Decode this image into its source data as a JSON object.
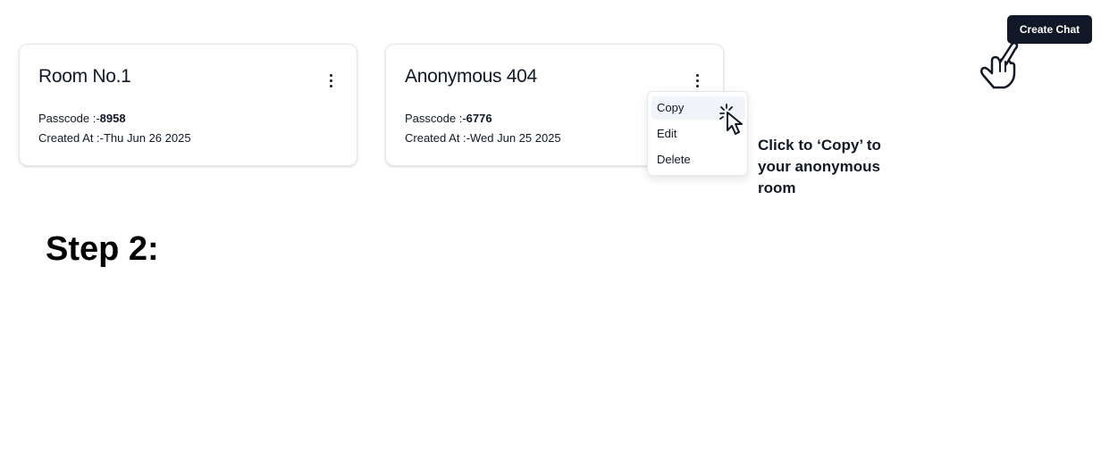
{
  "header": {
    "create_chat_label": "Create Chat"
  },
  "rooms": [
    {
      "title": "Room No.1",
      "passcode_label": "Passcode :-",
      "passcode": "8958",
      "created_label": "Created At :-",
      "created_at": "Thu Jun 26 2025"
    },
    {
      "title": "Anonymous 404",
      "passcode_label": "Passcode :-",
      "passcode": "6776",
      "created_label": "Created At :-",
      "created_at": "Wed Jun 25 2025"
    }
  ],
  "dropdown": {
    "items": [
      "Copy",
      "Edit",
      "Delete"
    ],
    "highlighted": "Copy"
  },
  "annotation": {
    "text": "Click to ‘Copy’ to your anonymous room"
  },
  "step": {
    "heading": "Step 2:"
  },
  "icons": {
    "hand": "pointing-hand-icon",
    "cursor": "click-cursor-icon",
    "menu": "vertical-dots-icon"
  },
  "colors": {
    "button_bg": "#111827",
    "highlight_bg": "#f1f5f9",
    "card_border": "#e5e7eb"
  }
}
